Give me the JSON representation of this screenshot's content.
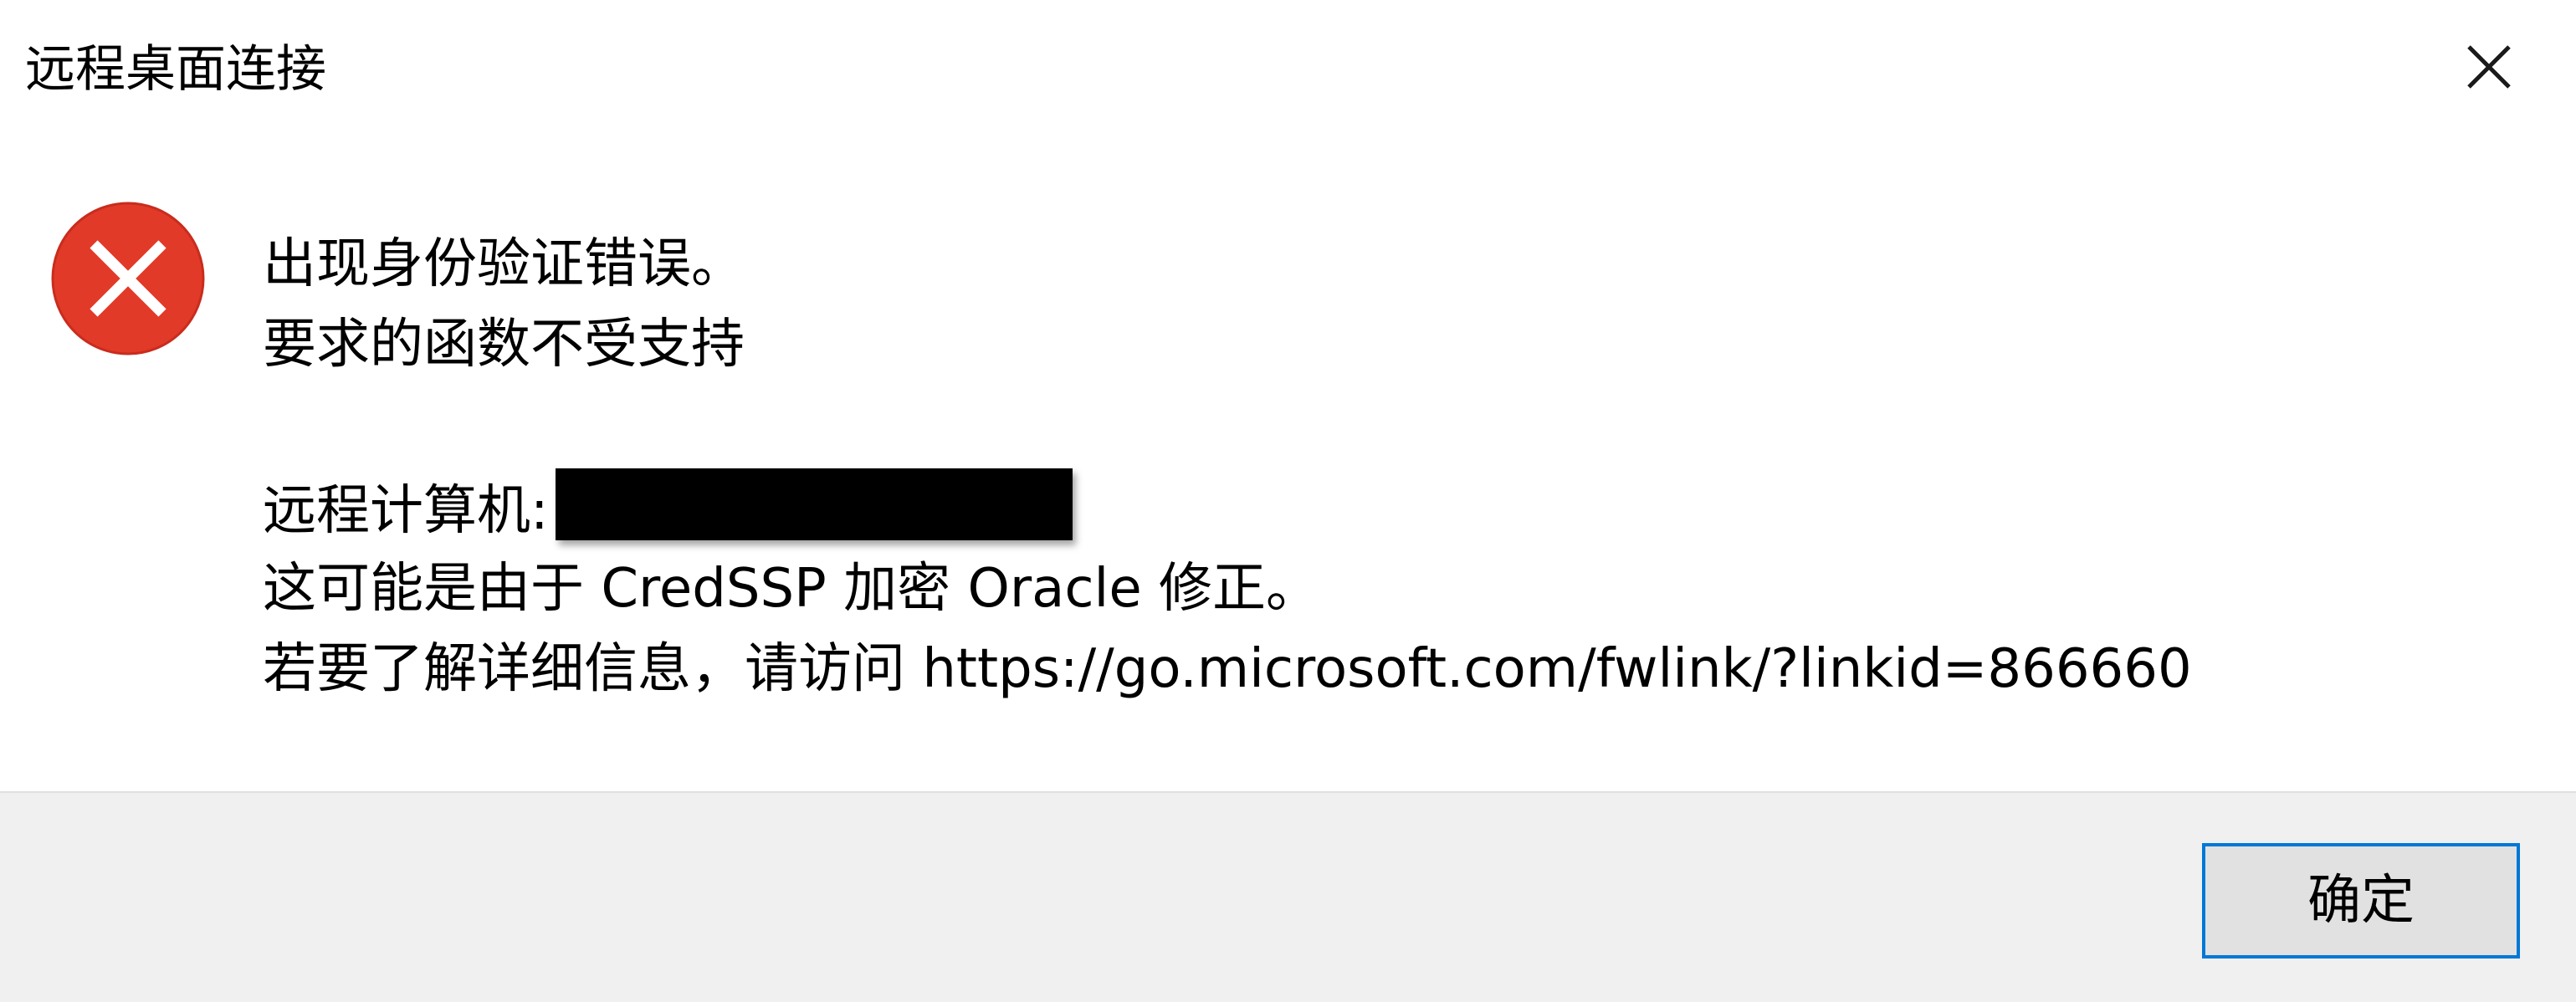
{
  "window": {
    "title": "远程桌面连接",
    "close_icon": "close-icon"
  },
  "message": {
    "icon": "error-icon",
    "icon_color": "#E23A28",
    "line1": "出现身份验证错误。",
    "line2": "要求的函数不受支持",
    "remote_computer_label": "远程计算机:",
    "line4": "这可能是由于 CredSSP 加密 Oracle 修正。",
    "line5": "若要了解详细信息，请访问 https://go.microsoft.com/fwlink/?linkid=866660"
  },
  "footer": {
    "ok_label": "确定",
    "accent": "#0078D7"
  }
}
